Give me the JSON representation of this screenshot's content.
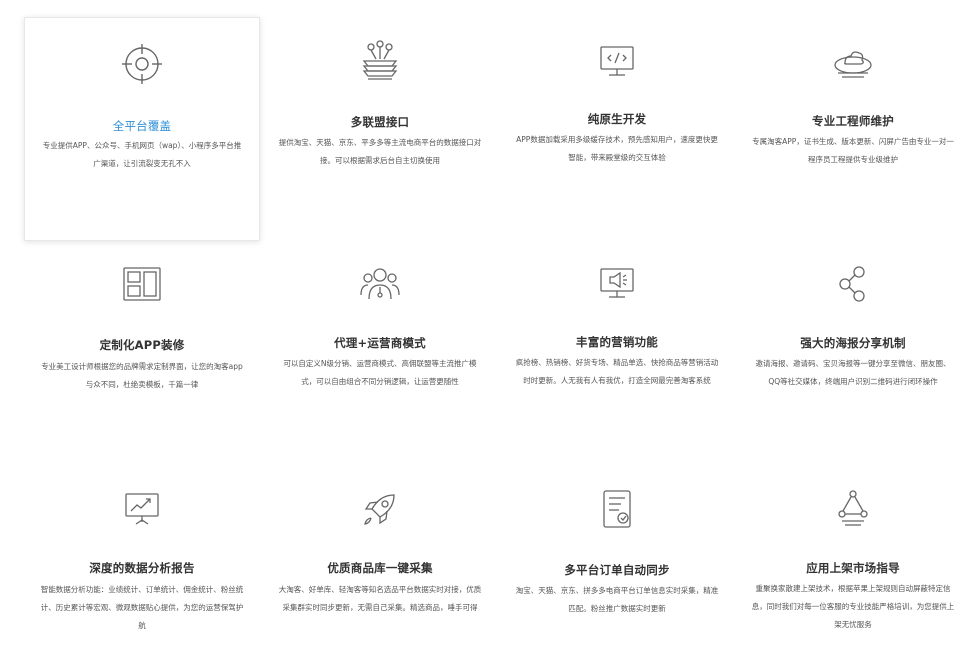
{
  "accent_color": "#2f8fd8",
  "features": [
    {
      "icon": "target-icon",
      "title": "全平台覆盖",
      "desc": "专业提供APP、公众号、手机网页（wap）、小程序多平台推广渠道，让引流裂变无孔不入"
    },
    {
      "icon": "multi-link-icon",
      "title": "多联盟接口",
      "desc": "提供淘宝、天猫、京东、平多多等主流电商平台的数据接口对接。可以根据需求后台自主切换使用"
    },
    {
      "icon": "code-monitor-icon",
      "title": "纯原生开发",
      "desc": "APP数据加载采用多级缓存技术，预先感知用户，速度更快更智能，带来殿堂级的交互体验"
    },
    {
      "icon": "cloud-icon",
      "title": "专业工程师维护",
      "desc": "专属淘客APP，证书生成、版本更新、闪屏广告由专业一对一程序员工程提供专业级维护"
    },
    {
      "icon": "layout-icon",
      "title": "定制化APP装修",
      "desc": "专业美工设计师根据您的品牌需求定制界面，让您的淘客app与众不同，杜绝卖模板，千篇一律"
    },
    {
      "icon": "agent-group-icon",
      "title": "代理+运营商模式",
      "desc": "可以自定义N级分销、运营商模式、高佣联盟等主流推广模式，可以自由组合不同分销逻辑，让运营更随性"
    },
    {
      "icon": "megaphone-monitor-icon",
      "title": "丰富的营销功能",
      "desc": "疯抢榜、热销榜、好货专场、精品单选、快抢商品等营销活动时时更新。人无我有人有我优，打造全网最完善淘客系统"
    },
    {
      "icon": "share-icon",
      "title": "强大的海报分享机制",
      "desc": "邀请海报、邀请码、宝贝海报等一键分享至微信、朋友圈、QQ等社交媒体，终端用户识别二维码进行闭环操作"
    },
    {
      "icon": "analytics-board-icon",
      "title": "深度的数据分析报告",
      "desc": "智能数据分析功能：业绩统计、订单统计、佣金统计、粉丝统计、历史累计等宏观、微观数据贴心提供，为您的运营保驾护航"
    },
    {
      "icon": "rocket-icon",
      "title": "优质商品库一键采集",
      "desc": "大淘客、好单库、轻淘客等知名选品平台数据实时对接，优质采集群实时同步更新，无需自己采集。精选商品，唾手可得"
    },
    {
      "icon": "order-sync-icon",
      "title": "多平台订单自动同步",
      "desc": "淘宝、天猫、京东、拼多多电商平台订单信息实时采集，精准匹配。粉丝推广数据实时更新"
    },
    {
      "icon": "network-triangle-icon",
      "title": "应用上架市场指导",
      "desc": "重聚换家散建上架技术，根据苹果上架规则自动屏蔽特定信息，同时我们对每一位客服的专业技能严格培训，为您提供上架无忧服务"
    }
  ]
}
